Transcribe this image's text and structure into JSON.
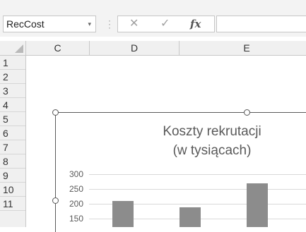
{
  "formula_bar": {
    "name_box": "RecCost",
    "name_box_arrow": "▾",
    "separator": "⋮",
    "cancel_symbol": "✕",
    "enter_symbol": "✓",
    "function_symbol": "fx",
    "formula_value": ""
  },
  "columns": [
    "C",
    "D",
    "E"
  ],
  "rows": [
    "1",
    "2",
    "3",
    "4",
    "5",
    "6",
    "7",
    "8",
    "9",
    "10",
    "11"
  ],
  "chart_data": {
    "type": "bar",
    "title_line1": "Koszty rekrutacji",
    "title_line2": "(w tysiącach)",
    "y_ticks": [
      "300",
      "250",
      "200",
      "150"
    ],
    "ylim": [
      150,
      300
    ],
    "values": [
      210,
      187,
      268
    ],
    "bar_color": "#8c8c8c"
  }
}
